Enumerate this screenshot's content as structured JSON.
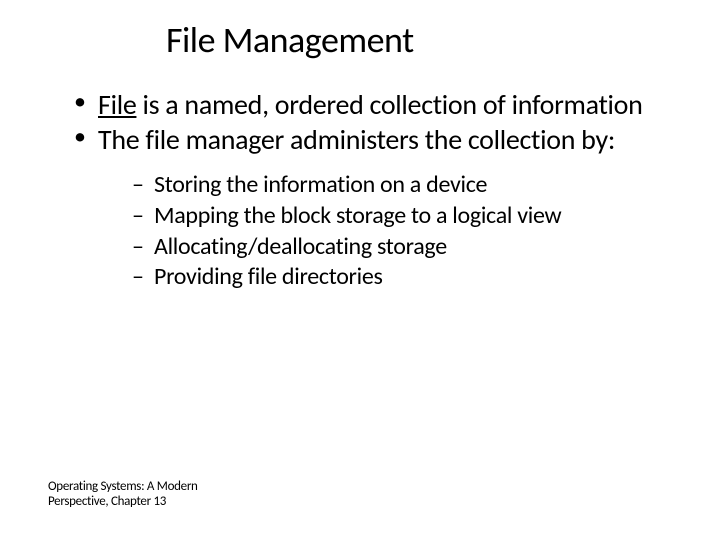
{
  "title": "File Management",
  "bullets": {
    "b1_term": "File",
    "b1_rest": " is a named, ordered collection of information",
    "b2": "The file manager administers the collection by:"
  },
  "subs": {
    "s1": "Storing the information on a device",
    "s2": "Mapping the block storage to a logical view",
    "s3": "Allocating/deallocating storage",
    "s4": "Providing file directories"
  },
  "footer": {
    "line1": "Operating Systems: A Modern",
    "line2": "Perspective, Chapter 13"
  }
}
